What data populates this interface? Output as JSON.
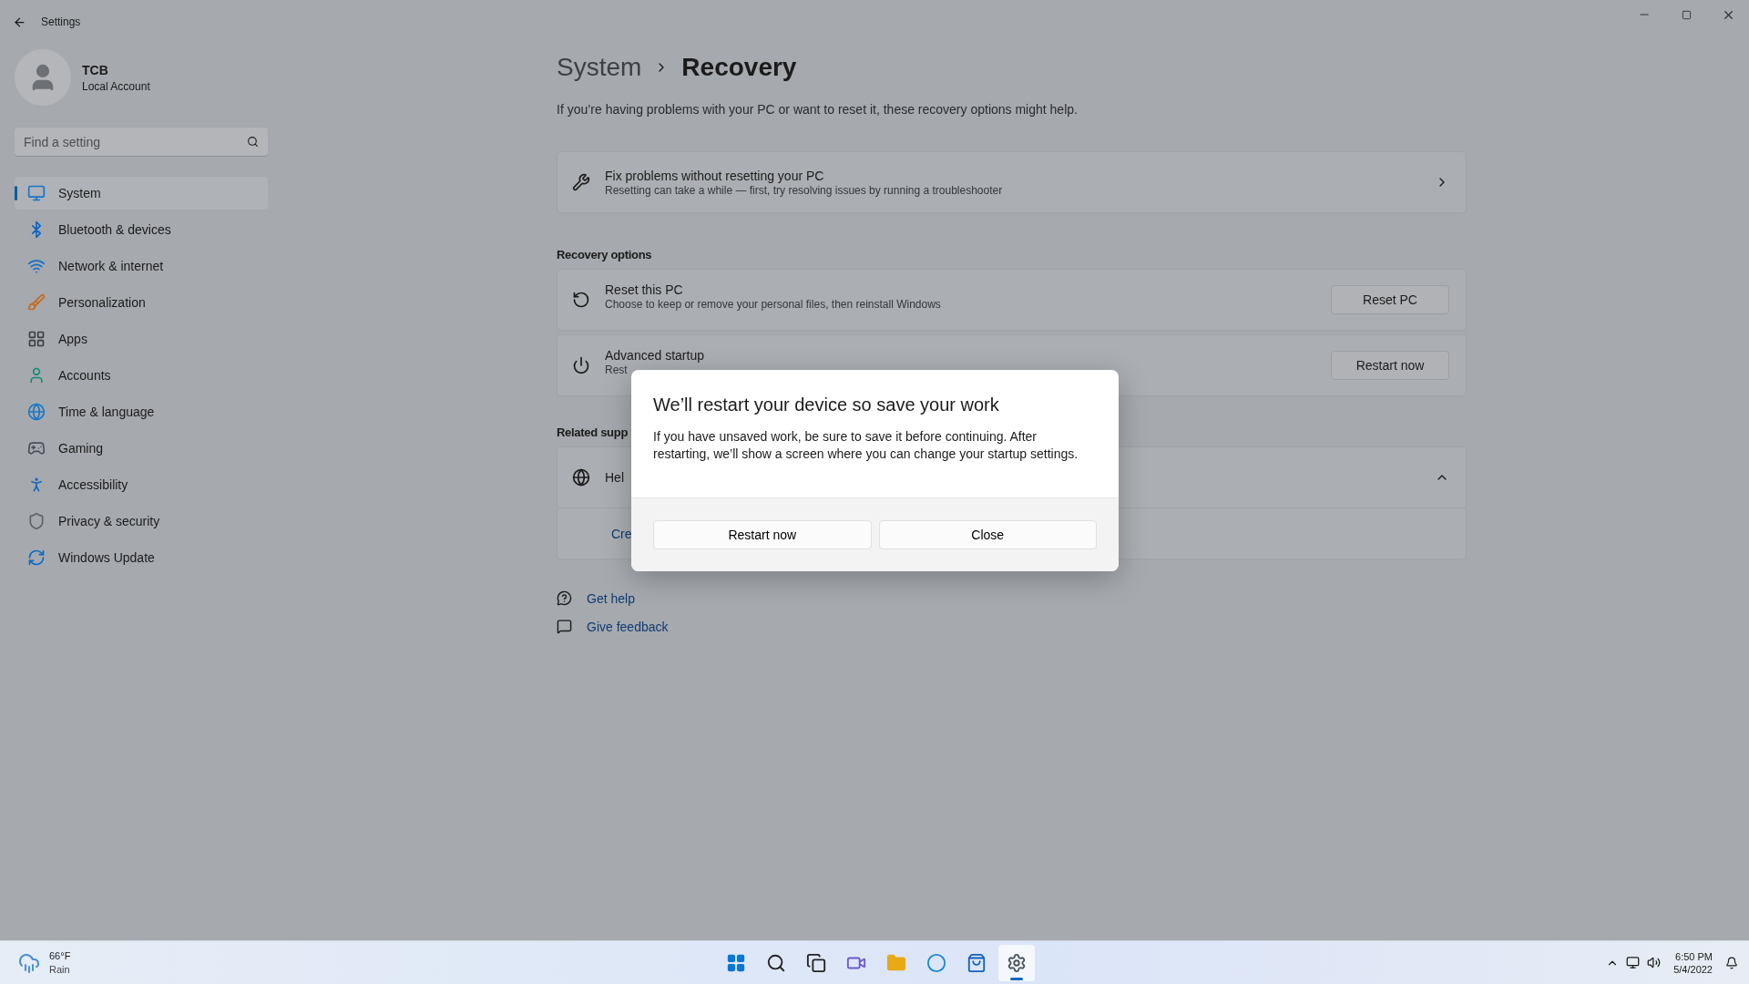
{
  "window": {
    "title": "Settings"
  },
  "account": {
    "name": "TCB",
    "type": "Local Account"
  },
  "search": {
    "placeholder": "Find a setting"
  },
  "nav": [
    {
      "label": "System",
      "kind": "system",
      "selected": true
    },
    {
      "label": "Bluetooth & devices",
      "kind": "bluetooth",
      "selected": false
    },
    {
      "label": "Network & internet",
      "kind": "network",
      "selected": false
    },
    {
      "label": "Personalization",
      "kind": "personalization",
      "selected": false
    },
    {
      "label": "Apps",
      "kind": "apps",
      "selected": false
    },
    {
      "label": "Accounts",
      "kind": "accounts",
      "selected": false
    },
    {
      "label": "Time & language",
      "kind": "time",
      "selected": false
    },
    {
      "label": "Gaming",
      "kind": "gaming",
      "selected": false
    },
    {
      "label": "Accessibility",
      "kind": "accessibility",
      "selected": false
    },
    {
      "label": "Privacy & security",
      "kind": "privacy",
      "selected": false
    },
    {
      "label": "Windows Update",
      "kind": "update",
      "selected": false
    }
  ],
  "breadcrumb": [
    "System",
    "Recovery"
  ],
  "description": "If you’re having problems with your PC or want to reset it, these recovery options might help.",
  "fix_card": {
    "title": "Fix problems without resetting your PC",
    "subtitle": "Resetting can take a while — first, try resolving issues by running a troubleshooter"
  },
  "recovery_options": {
    "heading": "Recovery options",
    "items": [
      {
        "kind": "reset",
        "title": "Reset this PC",
        "subtitle": "Choose to keep or remove your personal files, then reinstall Windows",
        "button": "Reset PC"
      },
      {
        "kind": "startup",
        "title": "Advanced startup",
        "subtitle": "Rest",
        "button": "Restart now"
      }
    ]
  },
  "related": {
    "heading": "Related supp",
    "title": "Hel",
    "expanded": true,
    "link": "Cre"
  },
  "links": [
    {
      "kind": "help",
      "label": "Get help"
    },
    {
      "kind": "feedback",
      "label": "Give feedback"
    }
  ],
  "dialog": {
    "title": "We’ll restart your device so save your work",
    "body": "If you have unsaved work, be sure to save it before continuing. After restarting, we’ll show a screen where you can change your startup settings.",
    "buttons": [
      "Restart now",
      "Close"
    ]
  },
  "taskbar": {
    "weather": {
      "temp": "66°F",
      "condition": "Rain"
    },
    "apps": [
      {
        "kind": "start",
        "selected": false
      },
      {
        "kind": "search",
        "selected": false
      },
      {
        "kind": "taskview",
        "selected": false
      },
      {
        "kind": "chat",
        "selected": false
      },
      {
        "kind": "explorer",
        "selected": false
      },
      {
        "kind": "edge",
        "selected": false
      },
      {
        "kind": "store",
        "selected": false
      },
      {
        "kind": "settings",
        "selected": true
      }
    ],
    "time": "6:50 PM",
    "date": "5/4/2022"
  }
}
